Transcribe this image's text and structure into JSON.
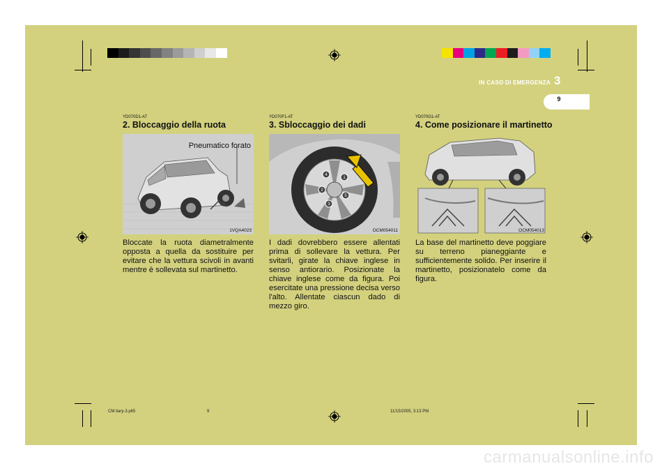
{
  "header": {
    "section_title": "IN CASO DI EMERGENZA",
    "section_number": "3",
    "page_number": "9"
  },
  "color_bars": {
    "grayscale": [
      "#000000",
      "#1c1c1c",
      "#343434",
      "#4e4e4e",
      "#686868",
      "#828282",
      "#9b9b9b",
      "#b5b5b5",
      "#cfcfcf",
      "#e8e8e8",
      "#ffffff"
    ],
    "colors": [
      "#f7e300",
      "#e8007c",
      "#00a2e5",
      "#2d2a87",
      "#00a650",
      "#ec1c24",
      "#1d1d1b",
      "#f49ac1",
      "#92d3f5",
      "#00aeef"
    ]
  },
  "columns": [
    {
      "code": "YD070D1-AT",
      "title": "2. Bloccaggio della ruota",
      "figure_code": "1VQA4023",
      "figure_callout": "Pneumatico forato",
      "body": "Bloccate la ruota diametralmente opposta a quella da sostituire per evitare che la vettura scivoli in avanti mentre è sollevata sul martinetto."
    },
    {
      "code": "YD070F1-AT",
      "title": "3. Sbloccaggio dei dadi",
      "figure_code": "OCM054011",
      "figure_numbers": [
        "1",
        "2",
        "3",
        "4",
        "5"
      ],
      "body": "I dadi dovrebbero essere allentati prima di sollevare la vettura. Per svitarli, girate la chiave inglese in senso antiorario. Posizionate la chiave inglese come da figura. Poi esercitate una pressione decisa verso l'alto. Allentate ciascun dado di mezzo giro."
    },
    {
      "code": "YD070G1-AT",
      "title": "4. Come posizionare il martinetto",
      "figure_code": "OCM054013",
      "body": "La base del martinetto deve poggiare su terreno pianeggiante e sufficientemente solido. Per inserire il martinetto, posizionatelo come da figura."
    }
  ],
  "footer": {
    "file": "CM itary-3.p65",
    "page": "9",
    "timestamp": "11/15/2005, 3:13 PM"
  },
  "watermark": "carmanualsonline.info"
}
